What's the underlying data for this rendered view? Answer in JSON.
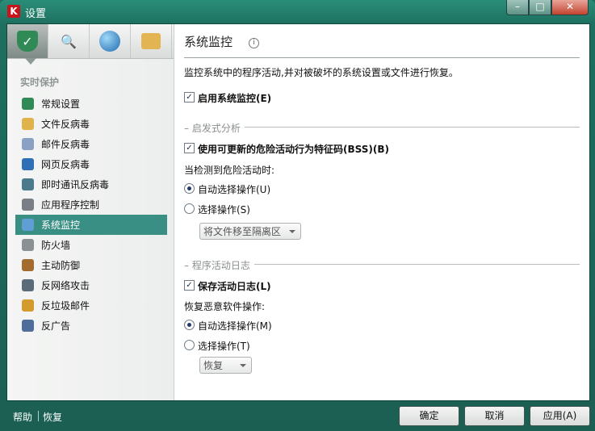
{
  "window": {
    "title": "设置",
    "app_logo": "K"
  },
  "toolbar_icons": [
    "shield-icon",
    "magnifier-icon",
    "globe-icon",
    "toolbox-icon"
  ],
  "sidebar": {
    "section": "实时保护",
    "items": [
      {
        "label": "常规设置",
        "icon": "shield-icon",
        "color": "#2f8a56"
      },
      {
        "label": "文件反病毒",
        "icon": "folder-icon",
        "color": "#e0b34a"
      },
      {
        "label": "邮件反病毒",
        "icon": "mail-icon",
        "color": "#8aa1c4"
      },
      {
        "label": "网页反病毒",
        "icon": "globe-icon",
        "color": "#2e6fb5"
      },
      {
        "label": "即时通讯反病毒",
        "icon": "chat-icon",
        "color": "#4a7a8c"
      },
      {
        "label": "应用程序控制",
        "icon": "funnel-icon",
        "color": "#7a7f86"
      },
      {
        "label": "系统监控",
        "icon": "monitor-icon",
        "color": "#5f9fd6"
      },
      {
        "label": "防火墙",
        "icon": "firewall-icon",
        "color": "#8a9193"
      },
      {
        "label": "主动防御",
        "icon": "defense-icon",
        "color": "#a46b2f"
      },
      {
        "label": "反网络攻击",
        "icon": "network-icon",
        "color": "#5a6b7a"
      },
      {
        "label": "反垃圾邮件",
        "icon": "spam-icon",
        "color": "#d49a2c"
      },
      {
        "label": "反广告",
        "icon": "ad-icon",
        "color": "#4f6d9a"
      }
    ],
    "selected_index": 6
  },
  "main": {
    "title": "系统监控",
    "description": "监控系统中的程序活动,并对被破坏的系统设置或文件进行恢复。",
    "enable_label": "启用系统监控(E)",
    "enable_checked": true,
    "heuristic": {
      "group_label": "启发式分析",
      "bss_label": "使用可更新的危险活动行为特征码(BSS)(B)",
      "bss_checked": true,
      "when_detected": "当检测到危险活动时:",
      "auto_label": "自动选择操作(U)",
      "select_label": "选择操作(S)",
      "action_combo": "将文件移至隔离区"
    },
    "log": {
      "group_label": "程序活动日志",
      "save_label": "保存活动日志(L)",
      "save_checked": true,
      "restore_heading": "恢复恶意软件操作:",
      "auto_label": "自动选择操作(M)",
      "select_label": "选择操作(T)",
      "restore_combo": "恢复"
    }
  },
  "footer": {
    "help": "帮助",
    "restore": "恢复",
    "ok": "确定",
    "cancel": "取消",
    "apply": "应用(A)"
  }
}
